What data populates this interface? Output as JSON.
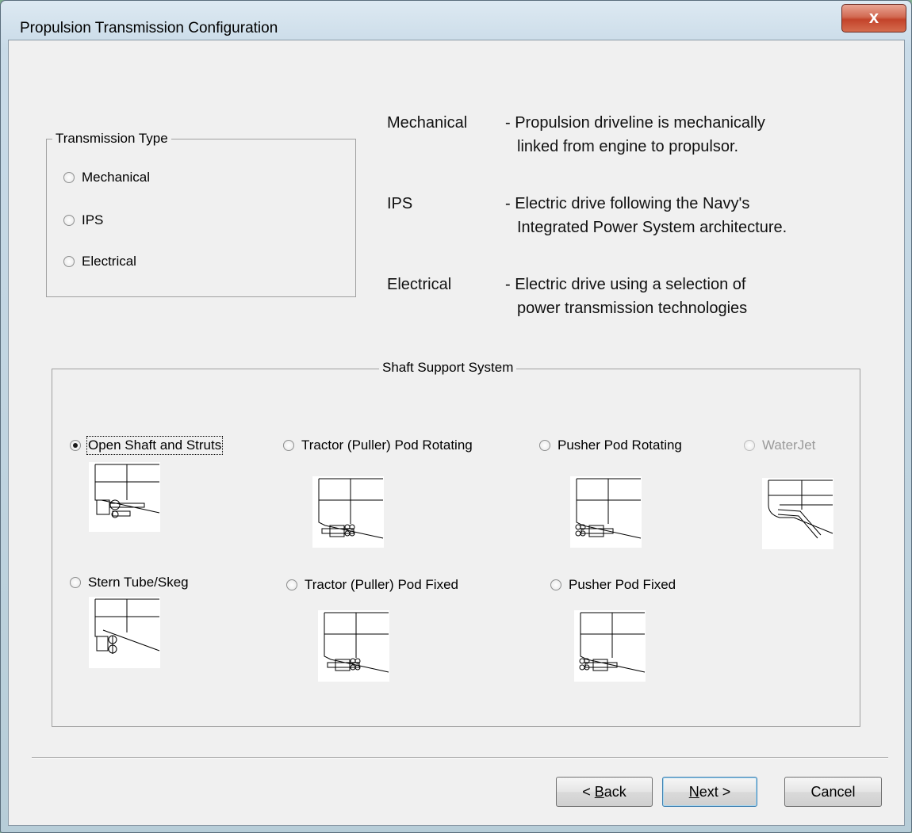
{
  "window": {
    "title": "Propulsion Transmission Configuration",
    "close_label": "x"
  },
  "transmission": {
    "legend": "Transmission Type",
    "options": [
      {
        "label": "Mechanical",
        "selected": false
      },
      {
        "label": "IPS",
        "selected": false
      },
      {
        "label": "Electrical",
        "selected": false
      }
    ]
  },
  "descriptions": [
    {
      "term": "Mechanical",
      "line1": "- Propulsion driveline is mechanically",
      "line2": "linked from engine to propulsor."
    },
    {
      "term": "IPS",
      "line1": "- Electric drive following the Navy's",
      "line2": "Integrated Power System architecture."
    },
    {
      "term": "Electrical",
      "line1": "- Electric drive using a selection of",
      "line2": "power transmission technologies"
    }
  ],
  "shaft": {
    "legend": "Shaft Support System",
    "options": [
      {
        "label": "Open Shaft and Struts",
        "selected": true,
        "enabled": true
      },
      {
        "label": "Tractor (Puller)  Pod Rotating",
        "selected": false,
        "enabled": true
      },
      {
        "label": "Pusher Pod Rotating",
        "selected": false,
        "enabled": true
      },
      {
        "label": "WaterJet",
        "selected": false,
        "enabled": false
      },
      {
        "label": "Stern Tube/Skeg",
        "selected": false,
        "enabled": true
      },
      {
        "label": "Tractor (Puller) Pod Fixed",
        "selected": false,
        "enabled": true
      },
      {
        "label": "Pusher Pod Fixed",
        "selected": false,
        "enabled": true
      }
    ]
  },
  "buttons": {
    "back_prefix": "< ",
    "back_key": "B",
    "back_rest": "ack",
    "next_key": "N",
    "next_rest": "ext >",
    "cancel": "Cancel"
  }
}
